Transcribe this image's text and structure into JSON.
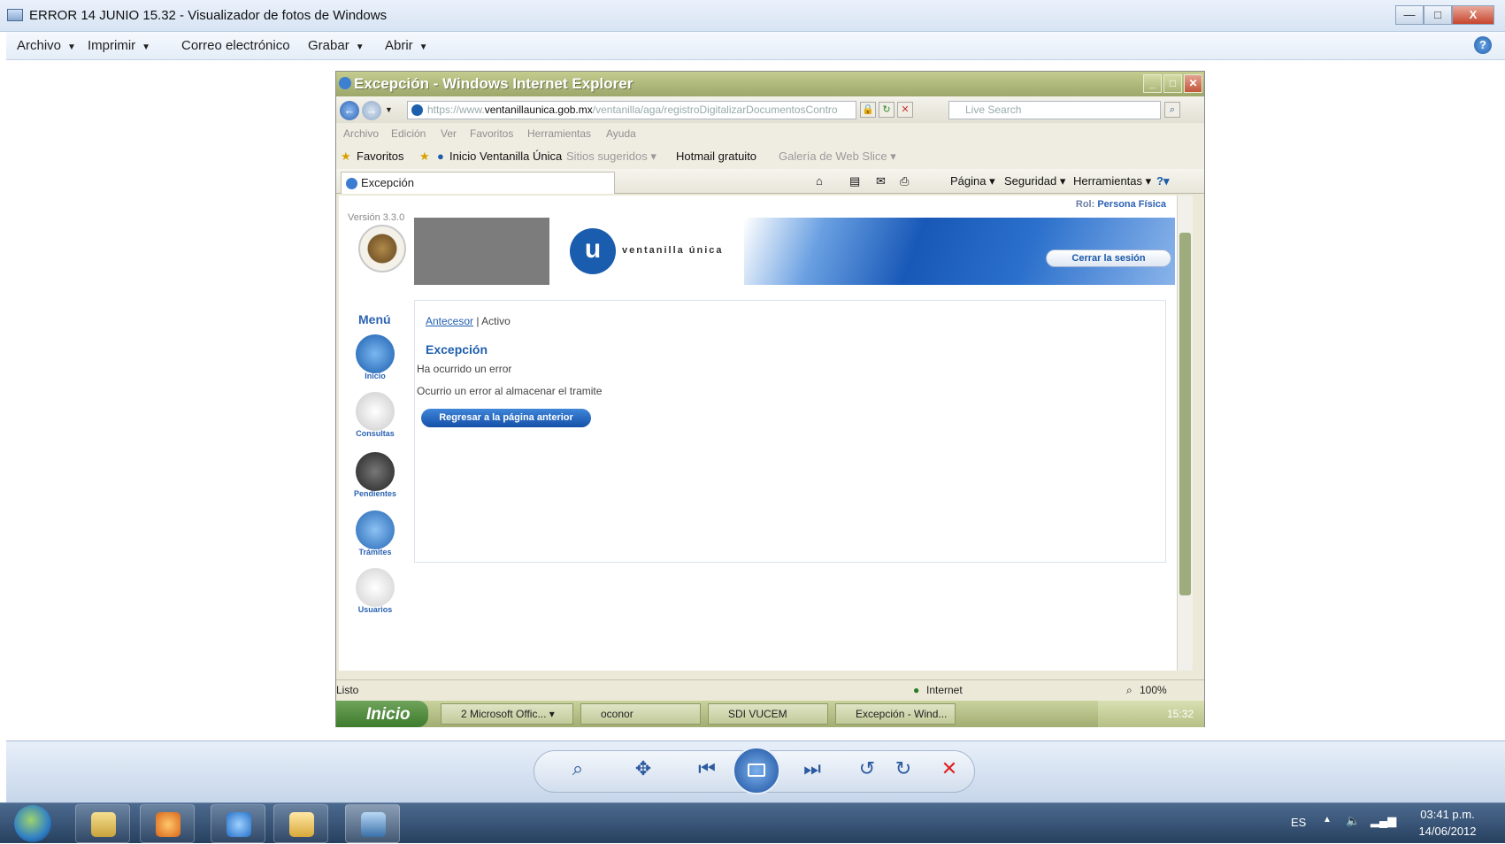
{
  "window": {
    "title": "ERROR 14 JUNIO 15.32 - Visualizador de fotos de Windows",
    "minimize": "—",
    "maximize": "□",
    "close": "X"
  },
  "menubar": {
    "archivo": "Archivo",
    "imprimir": "Imprimir",
    "correo": "Correo electrónico",
    "grabar": "Grabar",
    "abrir": "Abrir",
    "arrow": "▼",
    "help": "?"
  },
  "ie": {
    "title": "Excepción - Windows Internet Explorer",
    "url_scheme": "https://www.",
    "url_host": "ventanillaunica.gob.mx",
    "url_path": "/ventanilla/aga/registroDigitalizarDocumentosContro",
    "search_placeholder": "Live Search",
    "menu": [
      "Archivo",
      "Edición",
      "Ver",
      "Favoritos",
      "Herramientas",
      "Ayuda"
    ],
    "favorites": {
      "favoritos": "Favoritos",
      "inicio": "Inicio Ventanilla Única",
      "sitios": "Sitios sugeridos ▾",
      "hotmail": "Hotmail gratuito",
      "galeria": "Galería de Web Slice ▾"
    },
    "tab": "Excepción",
    "commands": {
      "pagina": "Página ▾",
      "seguridad": "Seguridad ▾",
      "herramientas": "Herramientas ▾",
      "help": "?▾"
    },
    "status": {
      "left": "Listo",
      "zone": "Internet",
      "zoom": "100%"
    }
  },
  "page": {
    "rol_label": "Rol:",
    "rol_value": "Persona Física",
    "version": "Versión 3.3.0",
    "logo_letter": "u",
    "logo_text": "ventanilla única",
    "close_session": "Cerrar la sesión",
    "menu_title": "Menú",
    "menu_items": [
      "Inicio",
      "Consultas",
      "Pendientes",
      "Trámites",
      "Usuarios"
    ],
    "breadcrumb_link": "Antecesor",
    "breadcrumb_sep": " | ",
    "breadcrumb_current": "Activo",
    "exception_title": "Excepción",
    "message1": "Ha ocurrido un error",
    "message2": "Ocurrio un error al almacenar el tramite",
    "back_button": "Regresar a la página anterior"
  },
  "xp_taskbar": {
    "start": "Inicio",
    "tasks": [
      "2 Microsoft Offic... ▾",
      "oconor",
      "SDI VUCEM",
      "Excepción - Wind..."
    ],
    "clock": "15:32"
  },
  "win7_taskbar": {
    "lang": "ES",
    "time": "03:41 p.m.",
    "date": "14/06/2012"
  },
  "colors": {
    "accent": "#1f5faf",
    "xp_green": "#a2ad72",
    "close_red": "#c6452d"
  }
}
